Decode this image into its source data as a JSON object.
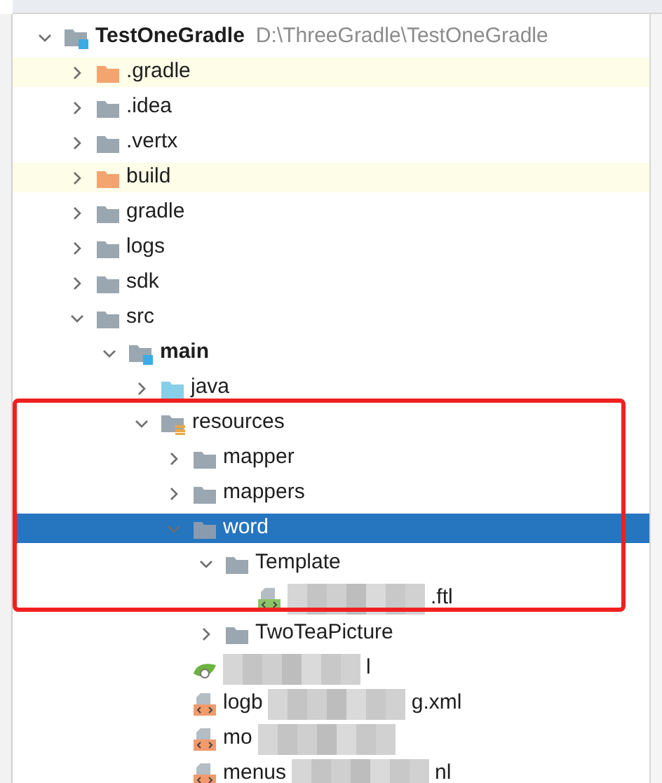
{
  "tree": [
    {
      "label": "TestOneGradle",
      "path": "D:\\ThreeGradle\\TestOneGradle",
      "kind": "module",
      "bold": true,
      "expanded": true,
      "selected": false,
      "children": [
        {
          "label": ".gradle",
          "kind": "excluded",
          "expanded": false,
          "selected": false
        },
        {
          "label": ".idea",
          "kind": "folder",
          "expanded": false,
          "selected": false
        },
        {
          "label": ".vertx",
          "kind": "folder",
          "expanded": false,
          "selected": false
        },
        {
          "label": "build",
          "kind": "excluded",
          "expanded": false,
          "selected": false
        },
        {
          "label": "gradle",
          "kind": "folder",
          "expanded": false,
          "selected": false
        },
        {
          "label": "logs",
          "kind": "folder",
          "expanded": false,
          "selected": false
        },
        {
          "label": "sdk",
          "kind": "folder",
          "expanded": false,
          "selected": false
        },
        {
          "label": "src",
          "kind": "folder",
          "expanded": true,
          "selected": false,
          "children": [
            {
              "label": "main",
              "kind": "module",
              "bold": true,
              "expanded": true,
              "selected": false,
              "children": [
                {
                  "label": "java",
                  "kind": "source",
                  "expanded": false,
                  "selected": false
                },
                {
                  "label": "resources",
                  "kind": "resources",
                  "expanded": true,
                  "selected": false,
                  "children": [
                    {
                      "label": "mapper",
                      "kind": "folder",
                      "expanded": false,
                      "selected": false
                    },
                    {
                      "label": "mappers",
                      "kind": "folder",
                      "expanded": false,
                      "selected": false
                    },
                    {
                      "label": "word",
                      "kind": "folder",
                      "expanded": true,
                      "selected": true,
                      "children": [
                        {
                          "label": "Template",
                          "kind": "folder",
                          "expanded": true,
                          "selected": false,
                          "children": [
                            {
                              "text_after": ".ftl",
                              "kind": "ftl",
                              "redacted": true,
                              "selected": false
                            }
                          ]
                        },
                        {
                          "label": "TwoTeaPicture",
                          "kind": "folder",
                          "expanded": false,
                          "selected": false
                        }
                      ]
                    },
                    {
                      "text_after": "l",
                      "kind": "spring",
                      "redacted": true,
                      "selected": false
                    },
                    {
                      "text_before": "logb",
                      "text_after": "g.xml",
                      "kind": "xml",
                      "redacted": true,
                      "selected": false
                    },
                    {
                      "text_before": "mo",
                      "kind": "xml",
                      "redacted": true,
                      "selected": false
                    },
                    {
                      "text_before": "menus",
                      "text_after": "nl",
                      "kind": "xml",
                      "redacted": true,
                      "selected": false
                    }
                  ]
                }
              ]
            }
          ]
        }
      ]
    }
  ]
}
